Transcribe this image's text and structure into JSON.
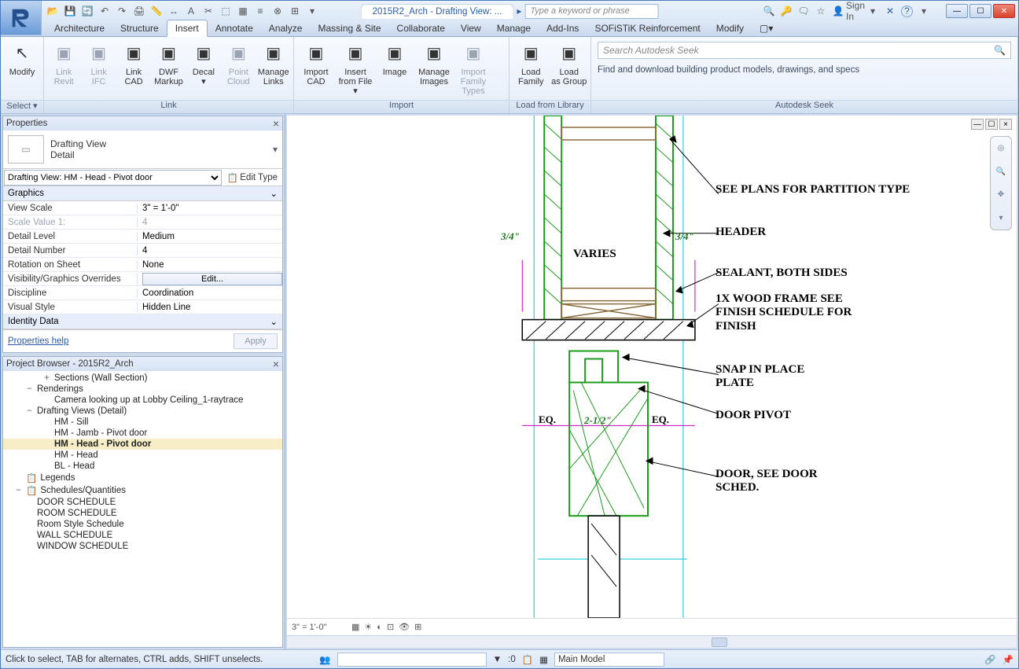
{
  "title": "2015R2_Arch - Drafting View: ...",
  "search_placeholder": "Type a keyword or phrase",
  "signin": "Sign In",
  "tabs": [
    "Architecture",
    "Structure",
    "Insert",
    "Annotate",
    "Analyze",
    "Massing & Site",
    "Collaborate",
    "View",
    "Manage",
    "Add-Ins",
    "SOFiSTiK Reinforcement",
    "Modify"
  ],
  "active_tab": "Insert",
  "ribbon": {
    "select": {
      "modify": "Modify",
      "panel": "Select ▾"
    },
    "link": {
      "buttons": [
        {
          "label": "Link Revit",
          "disabled": true
        },
        {
          "label": "Link IFC",
          "disabled": true
        },
        {
          "label": "Link CAD"
        },
        {
          "label": "DWF Markup"
        },
        {
          "label": "Decal ▾"
        },
        {
          "label": "Point Cloud",
          "disabled": true
        },
        {
          "label": "Manage Links"
        }
      ],
      "title": "Link"
    },
    "import": {
      "buttons": [
        {
          "label": "Import CAD"
        },
        {
          "label": "Insert from File ▾"
        },
        {
          "label": "Image"
        },
        {
          "label": "Manage Images"
        },
        {
          "label": "Import Family Types",
          "disabled": true
        }
      ],
      "title": "Import"
    },
    "library": {
      "buttons": [
        {
          "label": "Load Family"
        },
        {
          "label": "Load as Group"
        }
      ],
      "title": "Load from Library"
    },
    "seek": {
      "placeholder": "Search Autodesk Seek",
      "desc": "Find and download building product models, drawings, and specs",
      "title": "Autodesk Seek"
    }
  },
  "properties": {
    "title": "Properties",
    "type_name": "Drafting View",
    "type_sub": "Detail",
    "instance": "Drafting View: HM - Head - Pivot door",
    "edit_type": "Edit Type",
    "sections": [
      {
        "name": "Graphics",
        "rows": [
          {
            "name": "View Scale",
            "value": "3\" = 1'-0\""
          },
          {
            "name": "Scale Value   1:",
            "value": "4",
            "disabled": true
          },
          {
            "name": "Detail Level",
            "value": "Medium"
          },
          {
            "name": "Detail Number",
            "value": "4"
          },
          {
            "name": "Rotation on Sheet",
            "value": "None"
          },
          {
            "name": "Visibility/Graphics Overrides",
            "value": "Edit...",
            "button": true
          },
          {
            "name": "Discipline",
            "value": "Coordination"
          },
          {
            "name": "Visual Style",
            "value": "Hidden Line"
          }
        ]
      },
      {
        "name": "Identity Data",
        "rows": []
      }
    ],
    "help": "Properties help",
    "apply": "Apply"
  },
  "browser": {
    "title": "Project Browser - 2015R2_Arch",
    "nodes": [
      {
        "lvl": 2,
        "exp": "+",
        "label": "Sections (Wall Section)"
      },
      {
        "lvl": 1,
        "exp": "−",
        "label": "Renderings"
      },
      {
        "lvl": 2,
        "exp": "",
        "label": "Camera looking up at Lobby Ceiling_1-raytrace"
      },
      {
        "lvl": 1,
        "exp": "−",
        "label": "Drafting Views (Detail)"
      },
      {
        "lvl": 2,
        "exp": "",
        "label": "HM - Sill"
      },
      {
        "lvl": 2,
        "exp": "",
        "label": "HM - Jamb - Pivot door"
      },
      {
        "lvl": 2,
        "exp": "",
        "label": "HM - Head - Pivot door",
        "sel": true
      },
      {
        "lvl": 2,
        "exp": "",
        "label": "HM - Head"
      },
      {
        "lvl": 2,
        "exp": "",
        "label": "BL - Head"
      },
      {
        "lvl": 0,
        "exp": "",
        "label": "Legends",
        "icon": "📋"
      },
      {
        "lvl": 0,
        "exp": "−",
        "label": "Schedules/Quantities",
        "icon": "📋"
      },
      {
        "lvl": 1,
        "exp": "",
        "label": "DOOR SCHEDULE"
      },
      {
        "lvl": 1,
        "exp": "",
        "label": "ROOM SCHEDULE"
      },
      {
        "lvl": 1,
        "exp": "",
        "label": "Room Style Schedule"
      },
      {
        "lvl": 1,
        "exp": "",
        "label": "WALL SCHEDULE"
      },
      {
        "lvl": 1,
        "exp": "",
        "label": "WINDOW SCHEDULE"
      }
    ]
  },
  "canvas": {
    "scale": "3\" = 1'-0\"",
    "annotations": {
      "a1": "SEE PLANS FOR PARTITION TYPE",
      "a2": "HEADER",
      "a3": "SEALANT, BOTH SIDES",
      "a4": "1X WOOD FRAME SEE FINISH SCHEDULE FOR FINISH",
      "a5": "SNAP IN PLACE PLATE",
      "a6": "DOOR PIVOT",
      "a7": "DOOR, SEE DOOR SCHED."
    },
    "dims": {
      "d1": "3/4\"",
      "d2": "3/4\"",
      "varies": "VARIES",
      "eq1": "EQ.",
      "eq2": "EQ.",
      "d3": "2-1/2\""
    }
  },
  "status": {
    "msg": "Click to select, TAB for alternates, CTRL adds, SHIFT unselects.",
    "zero": ":0",
    "workset": "Main Model"
  }
}
